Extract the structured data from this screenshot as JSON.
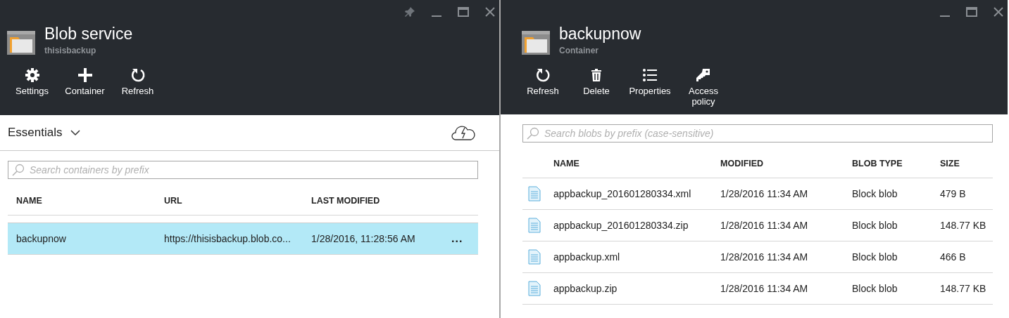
{
  "blades": [
    {
      "title": "Blob service",
      "subtitle": "thisisbackup",
      "window_controls": [
        {
          "kind": "pin"
        },
        {
          "kind": "minimize"
        },
        {
          "kind": "maximize"
        },
        {
          "kind": "close"
        }
      ],
      "actions": [
        {
          "kind": "settings",
          "label": "Settings"
        },
        {
          "kind": "add",
          "label": "Container"
        },
        {
          "kind": "refresh",
          "label": "Refresh"
        }
      ],
      "essentials": {
        "label": "Essentials",
        "expanded": false
      },
      "search": {
        "placeholder": "Search containers by prefix"
      },
      "table": {
        "columns": [
          "NAME",
          "URL",
          "LAST MODIFIED"
        ],
        "rows": [
          {
            "kind": "container",
            "cells": [
              "backupnow",
              "https://thisisbackup.blob.co...",
              "1/28/2016, 11:28:56 AM"
            ],
            "more": "...",
            "selected": true
          }
        ]
      }
    },
    {
      "title": "backupnow",
      "subtitle": "Container",
      "window_controls": [
        {
          "kind": "minimize"
        },
        {
          "kind": "maximize"
        },
        {
          "kind": "close"
        }
      ],
      "actions": [
        {
          "kind": "refresh",
          "label": "Refresh"
        },
        {
          "kind": "delete",
          "label": "Delete"
        },
        {
          "kind": "properties",
          "label": "Properties"
        },
        {
          "kind": "key",
          "label": "Access policy"
        }
      ],
      "search": {
        "placeholder": "Search blobs by prefix (case-sensitive)"
      },
      "table": {
        "columns": [
          "NAME",
          "MODIFIED",
          "BLOB TYPE",
          "SIZE"
        ],
        "rows": [
          {
            "kind": "file",
            "cells": [
              "appbackup_201601280334.xml",
              "1/28/2016 11:34 AM",
              "Block blob",
              "479 B"
            ],
            "selected": false
          },
          {
            "kind": "file",
            "cells": [
              "appbackup_201601280334.zip",
              "1/28/2016 11:34 AM",
              "Block blob",
              "148.77 KB"
            ],
            "selected": false
          },
          {
            "kind": "file",
            "cells": [
              "appbackup.xml",
              "1/28/2016 11:34 AM",
              "Block blob",
              "466 B"
            ],
            "selected": false
          },
          {
            "kind": "file",
            "cells": [
              "appbackup.zip",
              "1/28/2016 11:34 AM",
              "Block blob",
              "148.77 KB"
            ],
            "selected": false
          }
        ]
      }
    }
  ]
}
